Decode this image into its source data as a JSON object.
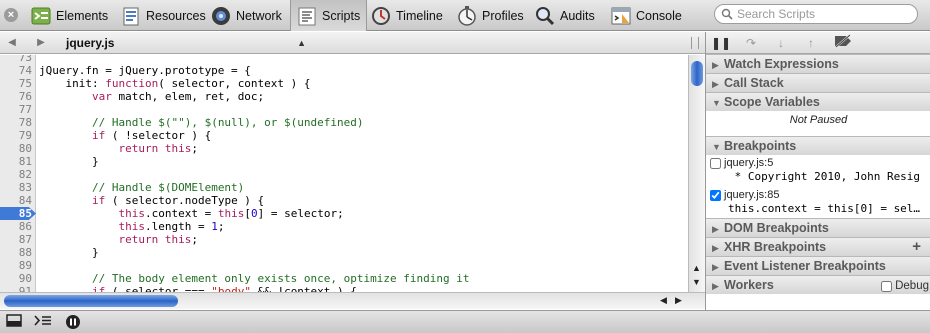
{
  "toolbar": {
    "items": [
      {
        "label": "Elements",
        "icon": "elements-icon"
      },
      {
        "label": "Resources",
        "icon": "resources-icon"
      },
      {
        "label": "Network",
        "icon": "network-icon"
      },
      {
        "label": "Scripts",
        "icon": "scripts-icon",
        "active": true
      },
      {
        "label": "Timeline",
        "icon": "timeline-icon"
      },
      {
        "label": "Profiles",
        "icon": "profiles-icon"
      },
      {
        "label": "Audits",
        "icon": "audits-icon"
      },
      {
        "label": "Console",
        "icon": "console-icon"
      }
    ],
    "search_placeholder": "Search Scripts"
  },
  "script_bar": {
    "file": "jquery.js"
  },
  "editor": {
    "lines": [
      {
        "n": "73",
        "text": ""
      },
      {
        "n": "74",
        "text": "jQuery.fn = jQuery.prototype = {"
      },
      {
        "n": "75",
        "text": "    init: function( selector, context ) {"
      },
      {
        "n": "76",
        "text": "        var match, elem, ret, doc;"
      },
      {
        "n": "77",
        "text": ""
      },
      {
        "n": "78",
        "text": "        // Handle $(\"\"), $(null), or $(undefined)"
      },
      {
        "n": "79",
        "text": "        if ( !selector ) {"
      },
      {
        "n": "80",
        "text": "            return this;"
      },
      {
        "n": "81",
        "text": "        }"
      },
      {
        "n": "82",
        "text": ""
      },
      {
        "n": "83",
        "text": "        // Handle $(DOMElement)"
      },
      {
        "n": "84",
        "text": "        if ( selector.nodeType ) {"
      },
      {
        "n": "85",
        "text": "            this.context = this[0] = selector;",
        "breakpoint": true
      },
      {
        "n": "86",
        "text": "            this.length = 1;"
      },
      {
        "n": "87",
        "text": "            return this;"
      },
      {
        "n": "88",
        "text": "        }"
      },
      {
        "n": "89",
        "text": ""
      },
      {
        "n": "90",
        "text": "        // The body element only exists once, optimize finding it"
      },
      {
        "n": "91",
        "text": "        if ( selector === \"body\" && !context ) {"
      }
    ]
  },
  "sidebar": {
    "panes": {
      "watch": "Watch Expressions",
      "call_stack": "Call Stack",
      "scope": "Scope Variables",
      "not_paused": "Not Paused",
      "breakpoints": "Breakpoints",
      "dom_breakpoints": "DOM Breakpoints",
      "xhr_breakpoints": "XHR Breakpoints",
      "event_listener_breakpoints": "Event Listener Breakpoints",
      "workers": "Workers",
      "workers_debug": "Debug"
    },
    "breakpoints": [
      {
        "label": "jquery.js:5",
        "source": " * Copyright 2010, John Resig",
        "checked": false
      },
      {
        "label": "jquery.js:85",
        "source": "this.context = this[0] = sel…",
        "checked": true
      }
    ]
  },
  "colors": {
    "breakpoint": "#3e7ad6",
    "keyword": "#a71d5d",
    "comment": "#236e25",
    "string": "#c41a16",
    "number": "#1c00cf"
  }
}
